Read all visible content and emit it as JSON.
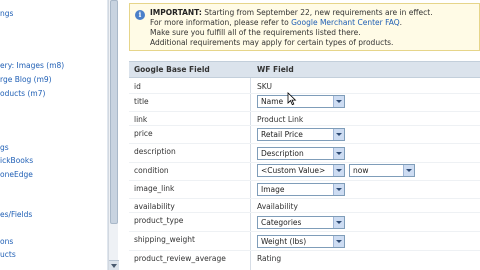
{
  "sidebar": {
    "items": [
      {
        "label": "ngs",
        "link": true
      },
      {
        "label": "ery: Images (m8)",
        "link": true
      },
      {
        "label": "rge Blog (m9)",
        "link": true
      },
      {
        "label": "oducts (m7)",
        "link": true
      },
      {
        "label": "gs",
        "link": true
      },
      {
        "label": "ickBooks",
        "link": true
      },
      {
        "label": "oneEdge",
        "link": true
      },
      {
        "label": "es/Fields",
        "link": true
      },
      {
        "label": "ons",
        "link": true
      },
      {
        "label": "ucts",
        "link": true
      }
    ]
  },
  "notice": {
    "title": "IMPORTANT:",
    "line1_rest": "Starting from September 22, new requirements are in effect.",
    "line2_pre": "For more information, please refer to",
    "line2_link": "Google Merchant Center FAQ",
    "line2_post": ".",
    "line3": "Make sure you fulfill all of the requirements listed there.",
    "line4": "Additional requirements may apply for certain types of products."
  },
  "table": {
    "col1_header": "Google Base Field",
    "col2_header": "WF Field",
    "rows": [
      {
        "field": "id",
        "value": "SKU",
        "type": "text"
      },
      {
        "field": "title",
        "value": "Name",
        "type": "select"
      },
      {
        "field": "link",
        "value": "Product Link",
        "type": "text"
      },
      {
        "field": "price",
        "value": "Retail Price",
        "type": "select"
      },
      {
        "field": "description",
        "value": "Description",
        "type": "select"
      },
      {
        "field": "condition",
        "value": "<Custom Value>",
        "type": "select",
        "extra": "now"
      },
      {
        "field": "image_link",
        "value": "Image",
        "type": "select"
      },
      {
        "field": "availability",
        "value": "Availability",
        "type": "text"
      },
      {
        "field": "product_type",
        "value": "Categories",
        "type": "select"
      },
      {
        "field": "shipping_weight",
        "value": "Weight (lbs)",
        "type": "select"
      },
      {
        "field": "product_review_average",
        "value": "Rating",
        "type": "text"
      }
    ]
  }
}
